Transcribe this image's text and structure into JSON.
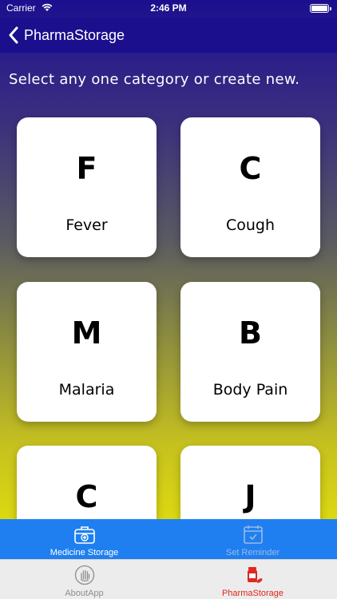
{
  "status_bar": {
    "carrier": "Carrier",
    "time": "2:46 PM"
  },
  "nav": {
    "back_label": "PharmaStorage"
  },
  "instructions": "Select any one category or create new.",
  "categories": [
    {
      "letter": "F",
      "label": "Fever"
    },
    {
      "letter": "C",
      "label": "Cough"
    },
    {
      "letter": "M",
      "label": "Malaria"
    },
    {
      "letter": "B",
      "label": "Body Pain"
    },
    {
      "letter": "C",
      "label": ""
    },
    {
      "letter": "J",
      "label": ""
    }
  ],
  "inner_tabs": [
    {
      "label": "Medicine Storage",
      "icon": "medicine-box-icon",
      "selected": true
    },
    {
      "label": "Set Reminder",
      "icon": "calendar-check-icon",
      "selected": false
    }
  ],
  "outer_tabs": [
    {
      "label": "AboutApp",
      "icon": "hand-icon",
      "selected": false
    },
    {
      "label": "PharmaStorage",
      "icon": "pill-bottle-icon",
      "selected": true
    }
  ],
  "colors": {
    "nav_background": "#1b0f8e",
    "inner_tab_background": "#1f7ff0",
    "outer_tab_selected": "#e0281f",
    "outer_tab_unselected": "#8e8e93",
    "inner_tab_unselected": "#9bbbe6"
  }
}
